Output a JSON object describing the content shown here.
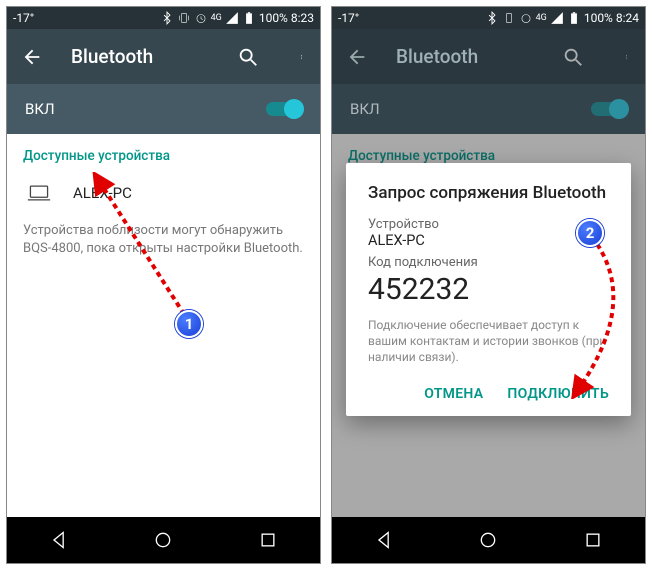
{
  "statusbar": {
    "temp": "-17°",
    "battery": "100%",
    "time1": "8:23",
    "time2": "8:24"
  },
  "appbar": {
    "title": "Bluetooth"
  },
  "toggle": {
    "label": "ВКЛ"
  },
  "section": {
    "available": "Доступные устройства"
  },
  "device": {
    "name": "ALEX-PC"
  },
  "hint": {
    "line": "Устройства поблизости могут обнаружить BQS-4800, пока открыты настройки Bluetooth."
  },
  "dialog": {
    "title": "Запрос сопряжения Bluetooth",
    "device_label": "Устройство",
    "device_name": "ALEX-PC",
    "code_label": "Код подключения",
    "code": "452232",
    "hint": "Подключение обеспечивает доступ к вашим контактам и истории звонков (при наличии связи).",
    "cancel": "ОТМЕНА",
    "pair": "ПОДКЛЮЧИТЬ"
  },
  "annotations": {
    "b1": "1",
    "b2": "2"
  }
}
